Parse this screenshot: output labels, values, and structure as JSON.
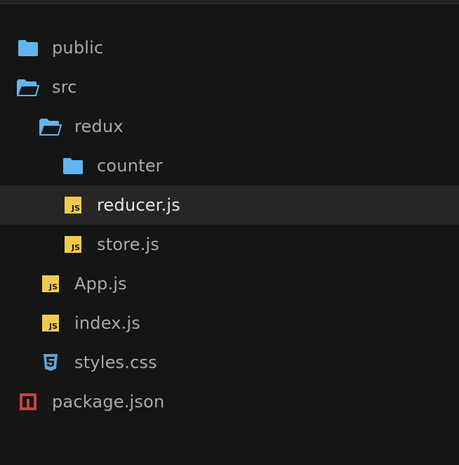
{
  "colors": {
    "background": "#151515",
    "selected_row": "#262626",
    "folder_icon": "#62b5ef",
    "js_badge": "#f2c94c",
    "css_icon": "#5ea4d8",
    "npm_icon": "#c1473b",
    "text": "#a9a9a9",
    "text_selected": "#e6e6e6"
  },
  "tree": [
    {
      "label": "public",
      "icon": "folder-closed-icon",
      "depth": 0
    },
    {
      "label": "src",
      "icon": "folder-open-icon",
      "depth": 0
    },
    {
      "label": "redux",
      "icon": "folder-open-icon",
      "depth": 1
    },
    {
      "label": "counter",
      "icon": "folder-closed-icon",
      "depth": 2
    },
    {
      "label": "reducer.js",
      "icon": "js-file-icon",
      "badge": "JS",
      "depth": 2,
      "selected": true
    },
    {
      "label": "store.js",
      "icon": "js-file-icon",
      "badge": "JS",
      "depth": 2
    },
    {
      "label": "App.js",
      "icon": "js-file-icon",
      "badge": "JS",
      "depth": 1
    },
    {
      "label": "index.js",
      "icon": "js-file-icon",
      "badge": "JS",
      "depth": 1
    },
    {
      "label": "styles.css",
      "icon": "css-file-icon",
      "depth": 1
    },
    {
      "label": "package.json",
      "icon": "npm-package-icon",
      "depth": 0
    }
  ]
}
